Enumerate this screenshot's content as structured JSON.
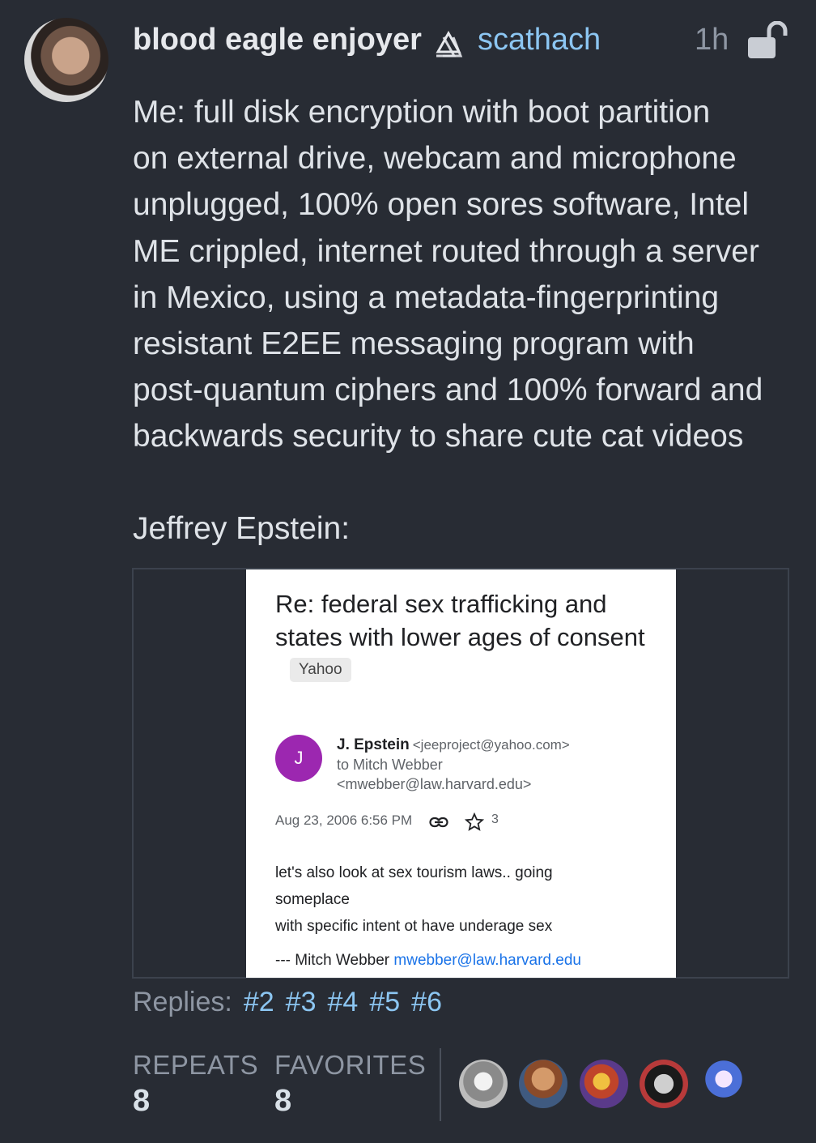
{
  "post": {
    "display_name": "blood eagle enjoyer",
    "handle": "scathach",
    "time": "1h",
    "text": "Me: full disk encryption with boot partition\non external drive, webcam and microphone\nunplugged, 100% open sores software, Intel\nME crippled, internet routed through a server\nin Mexico, using a metadata-fingerprinting\nresistant E2EE messaging program with\npost-quantum ciphers and 100% forward and\nbackwards security to share cute cat videos",
    "text2": "Jeffrey Epstein:"
  },
  "email": {
    "subject": "Re: federal sex trafficking and states with lower ages of consent",
    "chip": "Yahoo",
    "avatar_letter": "J",
    "sender_name": "J. Epstein",
    "sender_email": "<jeeproject@yahoo.com>",
    "to_line": "to Mitch Webber",
    "to_email": "<mwebber@law.harvard.edu>",
    "date": "Aug 23, 2006 6:56 PM",
    "star_count": "3",
    "body_line1": "let's also look at sex tourism laws.. going",
    "body_line2": "someplace",
    "body_line3": "with specific intent ot have underage sex",
    "sig_prefix": "--- Mitch Webber ",
    "sig_email": "mwebber@law.harvard.edu"
  },
  "replies": {
    "label": "Replies:",
    "links": [
      "#2",
      "#3",
      "#4",
      "#5",
      "#6"
    ]
  },
  "stats": {
    "repeats_label": "REPEATS",
    "repeats_value": "8",
    "favorites_label": "FAVORITES",
    "favorites_value": "8"
  },
  "colors": {
    "background": "#282c34",
    "accent_link": "#8cc6f2",
    "email_avatar": "#9c27b0"
  }
}
